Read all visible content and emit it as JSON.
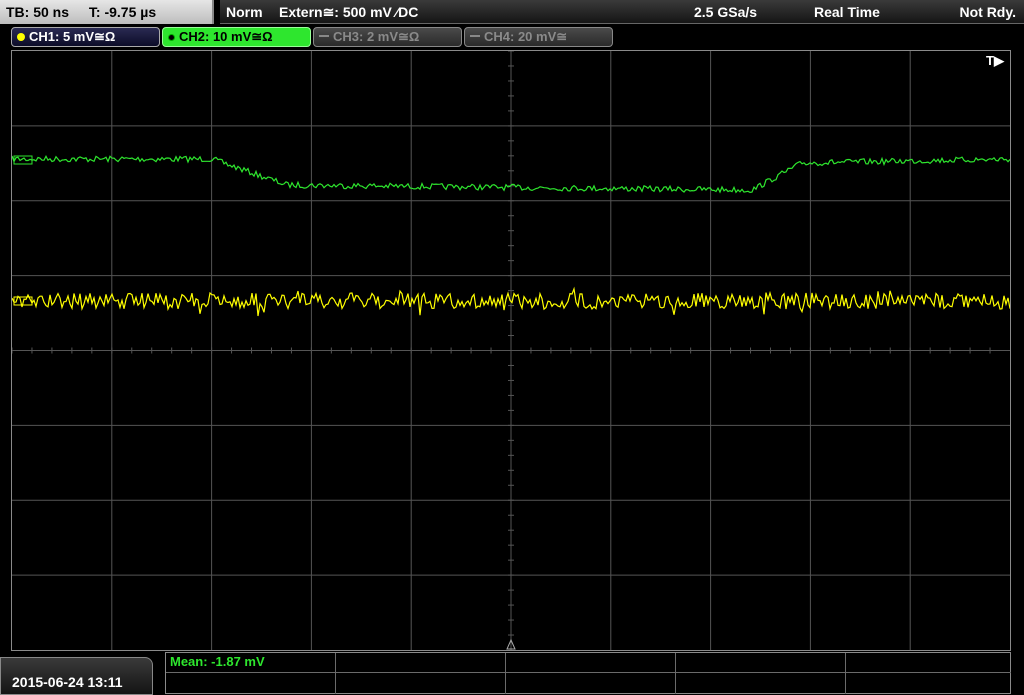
{
  "timebase": {
    "tb": "TB: 50 ns",
    "t": "T: -9.75 µs"
  },
  "status": {
    "mode": "Norm",
    "trigger": "Extern≅: 500 mV ⁄DC",
    "sample_rate": "2.5 GSa/s",
    "acq": "Real Time",
    "ready": "Not Rdy."
  },
  "channels": [
    {
      "label": "CH1: 5 mV≅Ω",
      "color": "#ffff00",
      "active": true
    },
    {
      "label": "CH2: 10 mV≅Ω",
      "color": "#2ee62e",
      "active": true,
      "selected": true
    },
    {
      "label": "CH3: 2 mV≅Ω",
      "color": "#8a8a8a",
      "active": false
    },
    {
      "label": "CH4: 20 mV≅",
      "color": "#8a8a8a",
      "active": false
    }
  ],
  "trigger_flag": "T▶",
  "measurement": {
    "mean": "Mean: -1.87 mV"
  },
  "datetime": "2015-06-24 13:11",
  "colors": {
    "ch1": "#ffff00",
    "ch2": "#2ee62e",
    "grid": "#555555"
  }
}
